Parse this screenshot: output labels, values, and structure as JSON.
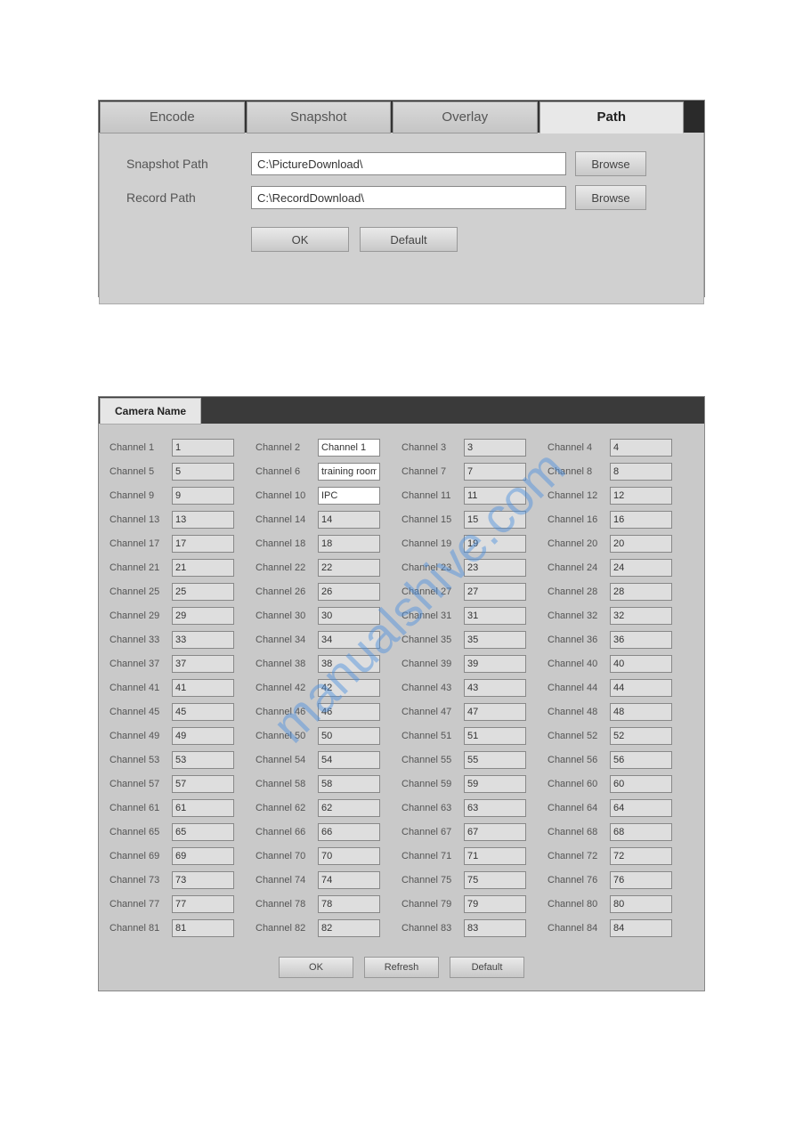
{
  "panel1": {
    "tabs": [
      "Encode",
      "Snapshot",
      "Overlay",
      "Path"
    ],
    "active_tab": "Path",
    "rows": [
      {
        "label": "Snapshot Path",
        "value": "C:\\PictureDownload\\",
        "browse": "Browse"
      },
      {
        "label": "Record Path",
        "value": "C:\\RecordDownload\\",
        "browse": "Browse"
      }
    ],
    "ok_label": "OK",
    "default_label": "Default"
  },
  "panel2": {
    "title": "Camera Name",
    "channels": [
      {
        "label": "Channel 1",
        "value": "1",
        "white": false
      },
      {
        "label": "Channel 2",
        "value": "Channel 1",
        "white": true
      },
      {
        "label": "Channel 3",
        "value": "3",
        "white": false
      },
      {
        "label": "Channel 4",
        "value": "4",
        "white": false
      },
      {
        "label": "Channel 5",
        "value": "5",
        "white": false
      },
      {
        "label": "Channel 6",
        "value": "training room",
        "white": true
      },
      {
        "label": "Channel 7",
        "value": "7",
        "white": false
      },
      {
        "label": "Channel 8",
        "value": "8",
        "white": false
      },
      {
        "label": "Channel 9",
        "value": "9",
        "white": false
      },
      {
        "label": "Channel 10",
        "value": "IPC",
        "white": true
      },
      {
        "label": "Channel 11",
        "value": "11",
        "white": false
      },
      {
        "label": "Channel 12",
        "value": "12",
        "white": false
      },
      {
        "label": "Channel 13",
        "value": "13",
        "white": false
      },
      {
        "label": "Channel 14",
        "value": "14",
        "white": false
      },
      {
        "label": "Channel 15",
        "value": "15",
        "white": false
      },
      {
        "label": "Channel 16",
        "value": "16",
        "white": false
      },
      {
        "label": "Channel 17",
        "value": "17",
        "white": false
      },
      {
        "label": "Channel 18",
        "value": "18",
        "white": false
      },
      {
        "label": "Channel 19",
        "value": "19",
        "white": false
      },
      {
        "label": "Channel 20",
        "value": "20",
        "white": false
      },
      {
        "label": "Channel 21",
        "value": "21",
        "white": false
      },
      {
        "label": "Channel 22",
        "value": "22",
        "white": false
      },
      {
        "label": "Channel 23",
        "value": "23",
        "white": false
      },
      {
        "label": "Channel 24",
        "value": "24",
        "white": false
      },
      {
        "label": "Channel 25",
        "value": "25",
        "white": false
      },
      {
        "label": "Channel 26",
        "value": "26",
        "white": false
      },
      {
        "label": "Channel 27",
        "value": "27",
        "white": false
      },
      {
        "label": "Channel 28",
        "value": "28",
        "white": false
      },
      {
        "label": "Channel 29",
        "value": "29",
        "white": false
      },
      {
        "label": "Channel 30",
        "value": "30",
        "white": false
      },
      {
        "label": "Channel 31",
        "value": "31",
        "white": false
      },
      {
        "label": "Channel 32",
        "value": "32",
        "white": false
      },
      {
        "label": "Channel 33",
        "value": "33",
        "white": false
      },
      {
        "label": "Channel 34",
        "value": "34",
        "white": false
      },
      {
        "label": "Channel 35",
        "value": "35",
        "white": false
      },
      {
        "label": "Channel 36",
        "value": "36",
        "white": false
      },
      {
        "label": "Channel 37",
        "value": "37",
        "white": false
      },
      {
        "label": "Channel 38",
        "value": "38",
        "white": false
      },
      {
        "label": "Channel 39",
        "value": "39",
        "white": false
      },
      {
        "label": "Channel 40",
        "value": "40",
        "white": false
      },
      {
        "label": "Channel 41",
        "value": "41",
        "white": false
      },
      {
        "label": "Channel 42",
        "value": "42",
        "white": false
      },
      {
        "label": "Channel 43",
        "value": "43",
        "white": false
      },
      {
        "label": "Channel 44",
        "value": "44",
        "white": false
      },
      {
        "label": "Channel 45",
        "value": "45",
        "white": false
      },
      {
        "label": "Channel 46",
        "value": "46",
        "white": false
      },
      {
        "label": "Channel 47",
        "value": "47",
        "white": false
      },
      {
        "label": "Channel 48",
        "value": "48",
        "white": false
      },
      {
        "label": "Channel 49",
        "value": "49",
        "white": false
      },
      {
        "label": "Channel 50",
        "value": "50",
        "white": false
      },
      {
        "label": "Channel 51",
        "value": "51",
        "white": false
      },
      {
        "label": "Channel 52",
        "value": "52",
        "white": false
      },
      {
        "label": "Channel 53",
        "value": "53",
        "white": false
      },
      {
        "label": "Channel 54",
        "value": "54",
        "white": false
      },
      {
        "label": "Channel 55",
        "value": "55",
        "white": false
      },
      {
        "label": "Channel 56",
        "value": "56",
        "white": false
      },
      {
        "label": "Channel 57",
        "value": "57",
        "white": false
      },
      {
        "label": "Channel 58",
        "value": "58",
        "white": false
      },
      {
        "label": "Channel 59",
        "value": "59",
        "white": false
      },
      {
        "label": "Channel 60",
        "value": "60",
        "white": false
      },
      {
        "label": "Channel 61",
        "value": "61",
        "white": false
      },
      {
        "label": "Channel 62",
        "value": "62",
        "white": false
      },
      {
        "label": "Channel 63",
        "value": "63",
        "white": false
      },
      {
        "label": "Channel 64",
        "value": "64",
        "white": false
      },
      {
        "label": "Channel 65",
        "value": "65",
        "white": false
      },
      {
        "label": "Channel 66",
        "value": "66",
        "white": false
      },
      {
        "label": "Channel 67",
        "value": "67",
        "white": false
      },
      {
        "label": "Channel 68",
        "value": "68",
        "white": false
      },
      {
        "label": "Channel 69",
        "value": "69",
        "white": false
      },
      {
        "label": "Channel 70",
        "value": "70",
        "white": false
      },
      {
        "label": "Channel 71",
        "value": "71",
        "white": false
      },
      {
        "label": "Channel 72",
        "value": "72",
        "white": false
      },
      {
        "label": "Channel 73",
        "value": "73",
        "white": false
      },
      {
        "label": "Channel 74",
        "value": "74",
        "white": false
      },
      {
        "label": "Channel 75",
        "value": "75",
        "white": false
      },
      {
        "label": "Channel 76",
        "value": "76",
        "white": false
      },
      {
        "label": "Channel 77",
        "value": "77",
        "white": false
      },
      {
        "label": "Channel 78",
        "value": "78",
        "white": false
      },
      {
        "label": "Channel 79",
        "value": "79",
        "white": false
      },
      {
        "label": "Channel 80",
        "value": "80",
        "white": false
      },
      {
        "label": "Channel 81",
        "value": "81",
        "white": false
      },
      {
        "label": "Channel 82",
        "value": "82",
        "white": false
      },
      {
        "label": "Channel 83",
        "value": "83",
        "white": false
      },
      {
        "label": "Channel 84",
        "value": "84",
        "white": false
      }
    ],
    "ok_label": "OK",
    "refresh_label": "Refresh",
    "default_label": "Default"
  },
  "watermark": "manualshive.com"
}
